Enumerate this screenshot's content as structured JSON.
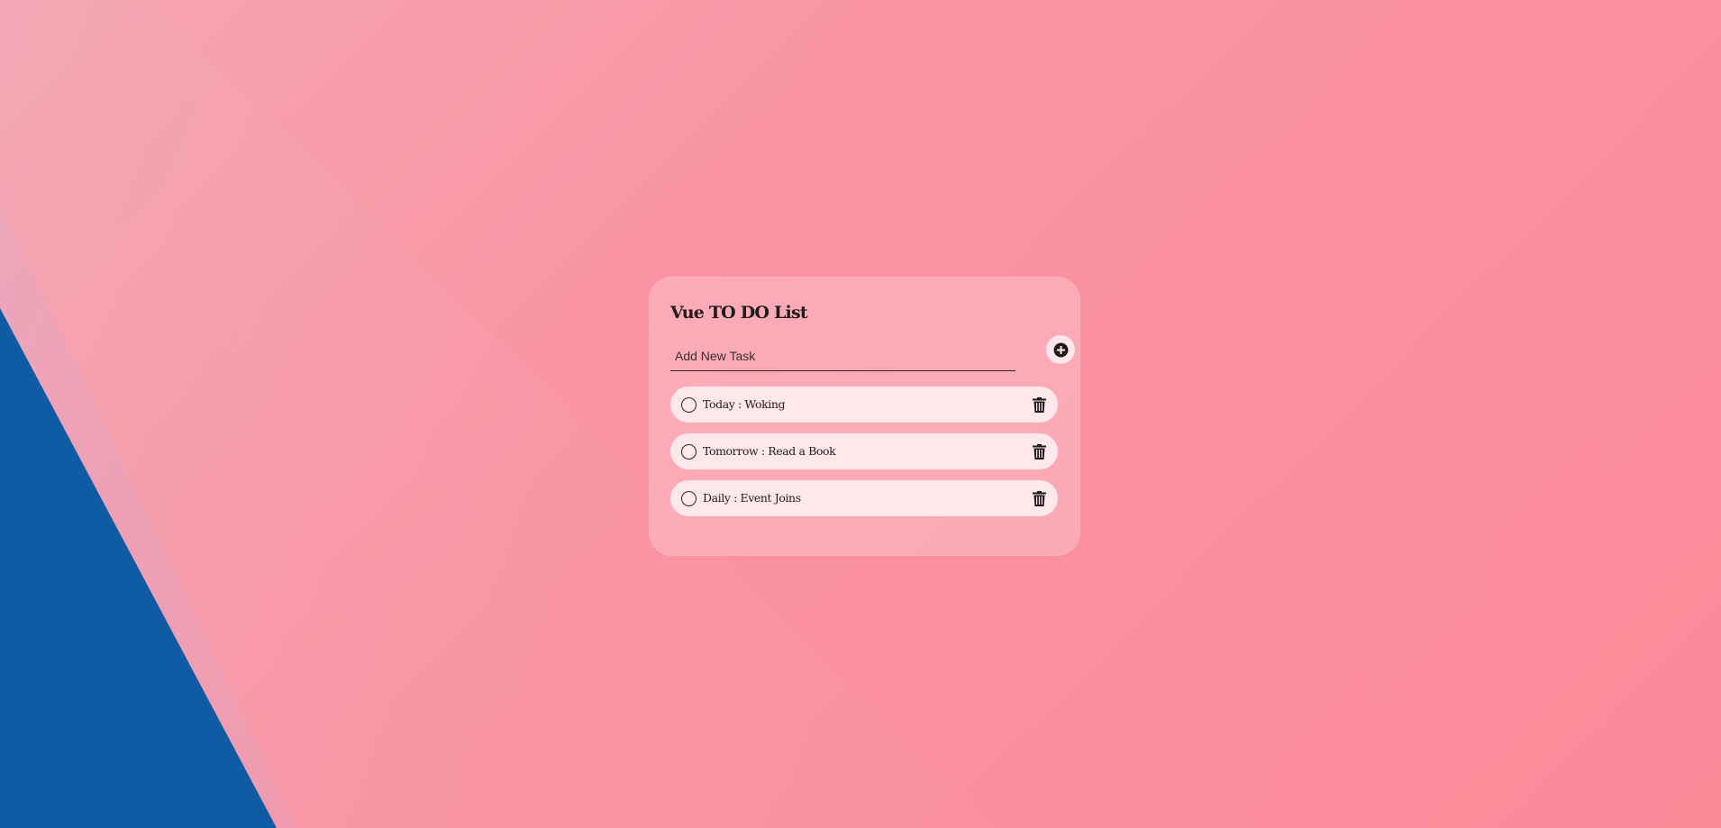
{
  "app": {
    "title": "Vue TO DO List"
  },
  "add_task": {
    "placeholder": "Add New Task",
    "value": "",
    "button_icon": "plus-circle-icon"
  },
  "tasks": [
    {
      "label": "Today : Woking",
      "completed": false,
      "delete_icon": "trash-icon"
    },
    {
      "label": "Tomorrow : Read a Book",
      "completed": false,
      "delete_icon": "trash-icon"
    },
    {
      "label": "Daily : Event Joins",
      "completed": false,
      "delete_icon": "trash-icon"
    }
  ],
  "colors": {
    "background_pink": "#fb8a99",
    "background_light": "#f6a6b2",
    "accent_blue": "#0f5ca4",
    "item_background": "#ffe8ec",
    "text": "#1f1a1c"
  }
}
